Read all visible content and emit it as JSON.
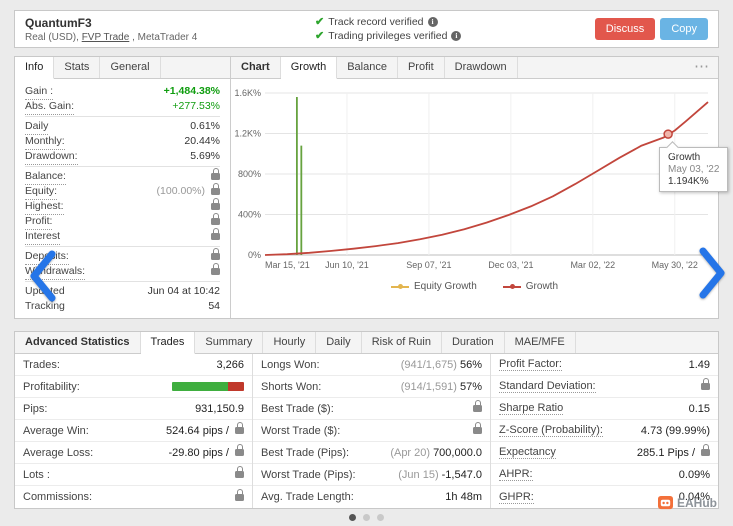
{
  "header": {
    "title": "QuantumF3",
    "subtitle": {
      "prefix": "Real (USD), ",
      "broker": "FVP Trade",
      "suffix": " , MetaTrader 4"
    },
    "verifications": [
      "Track record verified",
      "Trading privileges verified"
    ],
    "buttons": {
      "discuss": "Discuss",
      "copy": "Copy"
    }
  },
  "info_panel": {
    "tabs": [
      {
        "label": "Info",
        "active": true
      },
      {
        "label": "Stats",
        "active": false
      },
      {
        "label": "General",
        "active": false
      }
    ],
    "rows": [
      {
        "label": "Gain :",
        "value": "+1,484.38%",
        "style": "green-bold",
        "dotted": true
      },
      {
        "label": "Abs. Gain:",
        "value": "+277.53%",
        "style": "green",
        "dotted": true,
        "divider": true
      },
      {
        "label": "Daily",
        "value": "0.61%",
        "dotted": true
      },
      {
        "label": "Monthly:",
        "value": "20.44%",
        "dotted": true
      },
      {
        "label": "Drawdown:",
        "value": "5.69%",
        "dotted": true,
        "divider": true
      },
      {
        "label": "Balance:",
        "lock": true,
        "dotted": true
      },
      {
        "label": "Equity:",
        "muted": "(100.00%)",
        "lock": true,
        "dotted": true
      },
      {
        "label": "Highest:",
        "lock": true,
        "dotted": true
      },
      {
        "label": "Profit:",
        "lock": true,
        "dotted": true
      },
      {
        "label": "Interest",
        "lock": true,
        "dotted": true,
        "divider": true
      },
      {
        "label": "Deposits:",
        "lock": true,
        "dotted": true
      },
      {
        "label": "Withdrawals:",
        "lock": true,
        "dotted": true,
        "divider": true
      },
      {
        "label": "Updated",
        "value": "Jun 04 at 10:42"
      },
      {
        "label": "Tracking",
        "value": "54"
      }
    ]
  },
  "chart_panel": {
    "tabs": [
      {
        "label": "Chart",
        "active": false,
        "bold": true
      },
      {
        "label": "Growth",
        "active": true
      },
      {
        "label": "Balance",
        "active": false
      },
      {
        "label": "Profit",
        "active": false
      },
      {
        "label": "Drawdown",
        "active": false
      }
    ],
    "menu_icon": "⋯"
  },
  "chart_data": {
    "type": "line",
    "title": "Growth",
    "ylim": [
      0,
      1600
    ],
    "grid": true,
    "legend_position": "bottom",
    "y_ticks": [
      {
        "value": 0,
        "label": "0%"
      },
      {
        "value": 400,
        "label": "400%"
      },
      {
        "value": 800,
        "label": "800%"
      },
      {
        "value": 1200,
        "label": "1.2K%"
      },
      {
        "value": 1600,
        "label": "1.6K%"
      }
    ],
    "x_ticks": [
      {
        "frac": 0.0,
        "label": "Mar 15, '21"
      },
      {
        "frac": 0.185,
        "label": "Jun 10, '21"
      },
      {
        "frac": 0.37,
        "label": "Sep 07, '21"
      },
      {
        "frac": 0.555,
        "label": "Dec 03, '21"
      },
      {
        "frac": 0.74,
        "label": "Mar 02, '22"
      },
      {
        "frac": 0.925,
        "label": "May 30, '22"
      }
    ],
    "series": [
      {
        "name": "Equity Growth",
        "color": "#e3b54e",
        "type": "line",
        "points": []
      },
      {
        "name": "Growth",
        "color": "#c2463c",
        "type": "line",
        "points": [
          [
            0,
            0
          ],
          [
            0.05,
            8
          ],
          [
            0.1,
            22
          ],
          [
            0.15,
            40
          ],
          [
            0.2,
            62
          ],
          [
            0.25,
            88
          ],
          [
            0.3,
            118
          ],
          [
            0.35,
            155
          ],
          [
            0.4,
            200
          ],
          [
            0.45,
            255
          ],
          [
            0.5,
            320
          ],
          [
            0.55,
            395
          ],
          [
            0.6,
            480
          ],
          [
            0.65,
            580
          ],
          [
            0.7,
            700
          ],
          [
            0.75,
            830
          ],
          [
            0.8,
            960
          ],
          [
            0.85,
            1080
          ],
          [
            0.9,
            1160
          ],
          [
            0.925,
            1230
          ],
          [
            0.95,
            1320
          ],
          [
            0.975,
            1415
          ],
          [
            1.0,
            1510
          ]
        ]
      }
    ],
    "spikes": {
      "name": "Equity spike",
      "color": "#66a23f",
      "items": [
        {
          "frac": 0.072,
          "value": 1560
        },
        {
          "frac": 0.082,
          "value": 1080
        }
      ]
    },
    "marker": {
      "frac": 0.91,
      "value": 1194
    },
    "tooltip": {
      "series": "Growth",
      "date": "May 03, '22",
      "value": "1.194K%"
    },
    "legend": [
      {
        "label": "Equity Growth",
        "color": "#e3b54e"
      },
      {
        "label": "Growth",
        "color": "#c2463c"
      }
    ]
  },
  "stats_panel": {
    "tabs": [
      {
        "label": "Advanced Statistics",
        "active": false,
        "bold": true
      },
      {
        "label": "Trades",
        "active": true
      },
      {
        "label": "Summary",
        "active": false
      },
      {
        "label": "Hourly",
        "active": false
      },
      {
        "label": "Daily",
        "active": false
      },
      {
        "label": "Risk of Ruin",
        "active": false
      },
      {
        "label": "Duration",
        "active": false
      },
      {
        "label": "MAE/MFE",
        "active": false
      }
    ],
    "columns": [
      [
        {
          "label": "Trades:",
          "value": "3,266"
        },
        {
          "label": "Profitability:",
          "bar": {
            "green_pct": 78,
            "red_pct": 22
          }
        },
        {
          "label": "Pips:",
          "value": "931,150.9"
        },
        {
          "label": "Average Win:",
          "value": "524.64 pips /",
          "lock": true
        },
        {
          "label": "Average Loss:",
          "value": "-29.80 pips /",
          "lock": true
        },
        {
          "label": "Lots :",
          "lock": true
        },
        {
          "label": "Commissions:",
          "lock": true
        }
      ],
      [
        {
          "label": "Longs Won:",
          "muted": "(941/1,675)",
          "value": "56%"
        },
        {
          "label": "Shorts Won:",
          "muted": "(914/1,591)",
          "value": "57%"
        },
        {
          "label": "Best Trade ($):",
          "lock": true
        },
        {
          "label": "Worst Trade ($):",
          "lock": true
        },
        {
          "label": "Best Trade (Pips):",
          "muted": "(Apr 20)",
          "value": "700,000.0"
        },
        {
          "label": "Worst Trade (Pips):",
          "muted": "(Jun 15)",
          "value": "-1,547.0"
        },
        {
          "label": "Avg. Trade Length:",
          "value": "1h 48m"
        }
      ],
      [
        {
          "label": "Profit Factor:",
          "value": "1.49",
          "dotted": true
        },
        {
          "label": "Standard Deviation:",
          "lock": true,
          "dotted": true
        },
        {
          "label": "Sharpe Ratio",
          "value": "0.15",
          "dotted": true
        },
        {
          "label": "Z-Score (Probability):",
          "value": "4.73 (99.99%)",
          "dotted": true
        },
        {
          "label": "Expectancy",
          "value": "285.1 Pips /",
          "lock": true,
          "dotted": true
        },
        {
          "label": "AHPR:",
          "value": "0.09%",
          "dotted": true
        },
        {
          "label": "GHPR:",
          "value": "0.04%",
          "dotted": true
        }
      ]
    ]
  },
  "pagination": {
    "dots": 3,
    "active": 0
  },
  "brand": {
    "name": "EAHub"
  }
}
